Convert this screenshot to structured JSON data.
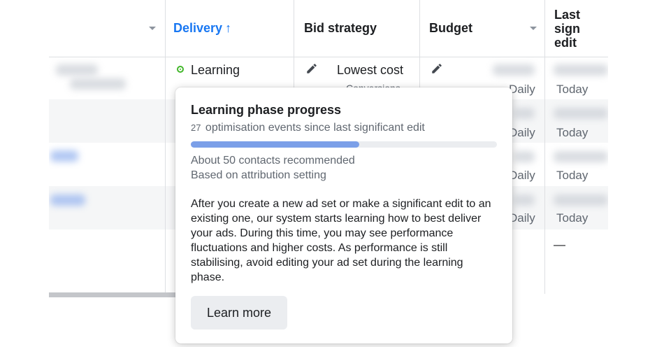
{
  "table": {
    "headers": {
      "delivery": "Delivery",
      "delivery_sort": "↑",
      "bid_strategy": "Bid strategy",
      "budget": "Budget",
      "last_edit_line1": "Last sign",
      "last_edit_line2": "edit"
    },
    "rows": [
      {
        "delivery": "Learning",
        "bid_strategy": "Lowest cost",
        "bid_sub": "Conversions",
        "budget_period": "Daily",
        "last_edit": "Today"
      },
      {
        "budget_period": "Daily",
        "last_edit": "Today"
      },
      {
        "budget_period": "Daily",
        "last_edit": "Today"
      },
      {
        "budget_period": "Daily",
        "last_edit": "Today"
      }
    ],
    "total_row": {
      "last_edit": "—"
    }
  },
  "popover": {
    "title": "Learning phase progress",
    "events_count": "27",
    "events_text": "optimisation events since last significant edit",
    "progress_fraction": 0.55,
    "recommended": "About 50 contacts recommended",
    "basis": "Based on attribution setting",
    "body": "After you create a new ad set or make a significant edit to an existing one, our system starts learning how to best deliver your ads. During this time, you may see performance fluctuations and higher costs. As performance is still stabilising, avoid editing your ad set during the learning phase.",
    "button_label": "Learn more"
  },
  "colors": {
    "delivery_header": "#1877f2",
    "learning_dot": "#42b72a",
    "progress_fill": "#7b9fe8"
  }
}
